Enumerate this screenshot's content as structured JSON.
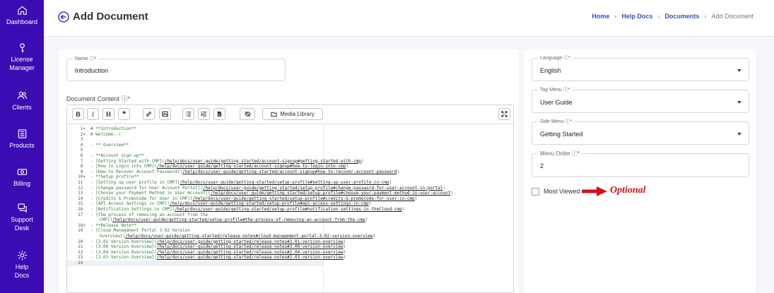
{
  "sidebar": {
    "items": [
      {
        "label": "Dashboard",
        "icon": "home-icon"
      },
      {
        "label": "License Manager",
        "icon": "key-icon"
      },
      {
        "label": "Clients",
        "icon": "users-icon"
      },
      {
        "label": "Products",
        "icon": "box-icon"
      },
      {
        "label": "Billing",
        "icon": "money-icon"
      },
      {
        "label": "Support Desk",
        "icon": "chat-icon"
      },
      {
        "label": "Help Docs",
        "icon": "gear-icon"
      }
    ]
  },
  "header": {
    "title": "Add Document",
    "breadcrumb": [
      "Home",
      "Help Docs",
      "Documents",
      "Add Document"
    ]
  },
  "form": {
    "name_label": "Name",
    "name_value": "Introduction",
    "doc_content_label": "Document Content",
    "media_library_label": "Media Library",
    "language_label": "Language",
    "language_value": "English",
    "top_menu_label": "Top Menu",
    "top_menu_value": "User Guide",
    "side_menu_label": "Side Menu",
    "side_menu_value": "Getting Started",
    "menu_order_label": "Menu Order",
    "menu_order_value": "2",
    "most_viewed_label": "Most Viewed",
    "optional_note": "Optional"
  },
  "editor": {
    "lines": [
      {
        "n": "1",
        "fold": "▾",
        "text": "# **Introduction**",
        "url": ""
      },
      {
        "n": "2",
        "fold": "▾",
        "text": "# Welcome..!",
        "url": ""
      },
      {
        "n": "3",
        "fold": "",
        "text": "",
        "url": ""
      },
      {
        "n": "4",
        "fold": "",
        "text": "- ** Overview**",
        "url": ""
      },
      {
        "n": "5",
        "fold": "",
        "text": "",
        "url": ""
      },
      {
        "n": "6",
        "fold": "",
        "text": "- **Account sign-up**",
        "url": ""
      },
      {
        "n": "7",
        "fold": "",
        "text": "  - [Getting Started with CMP](",
        "url": "/help/docs/user-guide/getting-started/account-signup#getting-started-with-cmp",
        "tail": ")"
      },
      {
        "n": "8",
        "fold": "",
        "text": "  - [How to Login into  CMP](",
        "url": "/help/docs/user-guide/getting-started/account-signup#how-to-login-into-cmp",
        "tail": ")"
      },
      {
        "n": "9",
        "fold": "",
        "text": "  - [How to Recover Account Password](",
        "url": "/help/docs/user-guide/getting-started/account-signup#how-to-recover-account-password",
        "tail": ")"
      },
      {
        "n": "10",
        "fold": "▾",
        "text": "- **Setup profile**",
        "url": ""
      },
      {
        "n": "11",
        "fold": "",
        "text": " - [Setting up user profile in CMP](",
        "url": "/help/docs/user-guide/getting-started/setup-profile#setting-up-user-profile-in-cmp",
        "tail": ")"
      },
      {
        "n": "12",
        "fold": "",
        "text": " - [Change password for User Account Portal](",
        "url": "/help/docs/user-guide/getting-started/setup-profile#change-password-for-user-account-in-portal",
        "tail": ")"
      },
      {
        "n": "13",
        "fold": "",
        "text": " - [Choose your Payment Method in User Account](",
        "url": "/help/docs/user-guide/getting-started/setup-profile#choose-your-payment-method-in-user-account",
        "tail": ")"
      },
      {
        "n": "14",
        "fold": "",
        "text": " - [Credits & Promocode for User in CMP](",
        "url": "/help/docs/user-guide/getting-started/setup-profile#credits-&-promocode-for-user-in-cmp",
        "tail": ")"
      },
      {
        "n": "15",
        "fold": "",
        "text": " - [API Access Settings in CMP](",
        "url": "/help/docs/user-guide/getting-started/setup-profile#api-access-settings-in-cmp",
        "tail": ")"
      },
      {
        "n": "16",
        "fold": "",
        "text": " - [Notification Settings in CMP](",
        "url": "/help/docs/user-guide/getting-started/setup-profile#notification-settings-in-theCloud-cmp",
        "tail": ")"
      },
      {
        "n": "17",
        "fold": "",
        "text": " - [The process of removing an account from the",
        "url": "",
        "tail": ""
      },
      {
        "n": "",
        "fold": "",
        "text": "CMP](",
        "url": "/help/docs/user-guide/getting-started/setup-profile#the-process-of-removing-an-account-from-the-cmp",
        "tail": ")",
        "cont": true
      },
      {
        "n": "18",
        "fold": "▾",
        "text": "- **Release Note**",
        "url": ""
      },
      {
        "n": "19",
        "fold": "",
        "text": "  - [Cloud Management Portal 3.02 Version",
        "url": "",
        "tail": ""
      },
      {
        "n": "",
        "fold": "",
        "text": "Overview](",
        "url": "/help/docs/user-guide/getting-started/release-notes#cloud-management-portal-3.02-version-overview",
        "tail": ")",
        "cont": true
      },
      {
        "n": "20",
        "fold": "",
        "text": "  - [3.01 Version Overview](",
        "url": "/help/docs/user-guide/getting-started/release-notes#3.01-version-overview",
        "tail": ")"
      },
      {
        "n": "21",
        "fold": "",
        "text": "  - [3.00 Version Overview](",
        "url": "/help/docs/user-guide/getting-started/release-notes#3.00-version-overview",
        "tail": ")"
      },
      {
        "n": "22",
        "fold": "",
        "text": "  - [2.04 Version Overview](",
        "url": "/help/docs/user-guide/getting-started/release-notes#2.04-version-overview",
        "tail": ")"
      },
      {
        "n": "23",
        "fold": "",
        "text": "  - [2.03 Version Overview](",
        "url": "/help/docs/user-guide/getting-started/release-notes#2.03-version-overview",
        "tail": ")"
      },
      {
        "n": "24",
        "fold": "",
        "text": "",
        "url": "",
        "hl": true
      }
    ]
  },
  "colors": {
    "sidebar_bg": "#3b0bb3",
    "breadcrumb_link": "#3b4ec0",
    "optional_red": "#d0121a",
    "code_green": "#2e7d32"
  }
}
